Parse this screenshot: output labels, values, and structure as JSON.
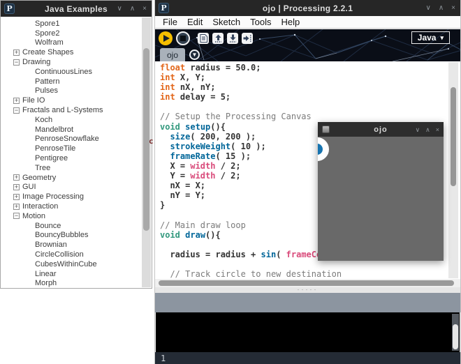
{
  "window_controls": {
    "minimize": "∨",
    "maximize": "∧",
    "close": "×"
  },
  "examples_window": {
    "logo": "P",
    "title": "Java Examples",
    "tree": [
      {
        "label": "Spore1",
        "level": 1,
        "toggle": null
      },
      {
        "label": "Spore2",
        "level": 1,
        "toggle": null
      },
      {
        "label": "Wolfram",
        "level": 1,
        "toggle": null
      },
      {
        "label": "Create Shapes",
        "level": 0,
        "toggle": "+"
      },
      {
        "label": "Drawing",
        "level": 0,
        "toggle": "−"
      },
      {
        "label": "ContinuousLines",
        "level": 1,
        "toggle": null
      },
      {
        "label": "Pattern",
        "level": 1,
        "toggle": null
      },
      {
        "label": "Pulses",
        "level": 1,
        "toggle": null
      },
      {
        "label": "File IO",
        "level": 0,
        "toggle": "+"
      },
      {
        "label": "Fractals and L-Systems",
        "level": 0,
        "toggle": "−"
      },
      {
        "label": "Koch",
        "level": 1,
        "toggle": null
      },
      {
        "label": "Mandelbrot",
        "level": 1,
        "toggle": null
      },
      {
        "label": "PenroseSnowflake",
        "level": 1,
        "toggle": null
      },
      {
        "label": "PenroseTile",
        "level": 1,
        "toggle": null
      },
      {
        "label": "Pentigree",
        "level": 1,
        "toggle": null
      },
      {
        "label": "Tree",
        "level": 1,
        "toggle": null
      },
      {
        "label": "Geometry",
        "level": 0,
        "toggle": "+"
      },
      {
        "label": "GUI",
        "level": 0,
        "toggle": "+"
      },
      {
        "label": "Image Processing",
        "level": 0,
        "toggle": "+"
      },
      {
        "label": "Interaction",
        "level": 0,
        "toggle": "+"
      },
      {
        "label": "Motion",
        "level": 0,
        "toggle": "−"
      },
      {
        "label": "Bounce",
        "level": 1,
        "toggle": null
      },
      {
        "label": "BouncyBubbles",
        "level": 1,
        "toggle": null
      },
      {
        "label": "Brownian",
        "level": 1,
        "toggle": null
      },
      {
        "label": "CircleCollision",
        "level": 1,
        "toggle": null
      },
      {
        "label": "CubesWithinCube",
        "level": 1,
        "toggle": null
      },
      {
        "label": "Linear",
        "level": 1,
        "toggle": null
      },
      {
        "label": "Morph",
        "level": 1,
        "toggle": null
      }
    ]
  },
  "editor_window": {
    "logo": "P",
    "title": "ojo | Processing 2.2.1",
    "menu": [
      "File",
      "Edit",
      "Sketch",
      "Tools",
      "Help"
    ],
    "toolbar": {
      "buttons": [
        "run-icon",
        "stop-icon",
        "new-sketch-icon",
        "open-icon",
        "save-icon",
        "export-icon"
      ],
      "mode_selector": {
        "label": "Java",
        "caret": "▾"
      }
    },
    "tab": {
      "label": "ojo",
      "menu_caret": "▼"
    },
    "splitter_dots": "·····",
    "status": {
      "line_number": "1"
    },
    "syntax_colors": {
      "keyword": "#E2661A",
      "type": "#33997E",
      "function": "#006699",
      "special_variable": "#D94A7A",
      "comment": "#7B7B7B",
      "plain": "#333333"
    },
    "code_lines": [
      {
        "tokens": [
          {
            "t": "float",
            "c": "kw"
          },
          {
            "t": " radius = 50.0;",
            "c": "pl"
          }
        ]
      },
      {
        "tokens": [
          {
            "t": "int",
            "c": "kw"
          },
          {
            "t": " X, Y;",
            "c": "pl"
          }
        ]
      },
      {
        "tokens": [
          {
            "t": "int",
            "c": "kw"
          },
          {
            "t": " nX, nY;",
            "c": "pl"
          }
        ]
      },
      {
        "tokens": [
          {
            "t": "int",
            "c": "kw"
          },
          {
            "t": " delay = 5;",
            "c": "pl"
          }
        ]
      },
      {
        "tokens": []
      },
      {
        "tokens": [
          {
            "t": "// Setup the Processing Canvas",
            "c": "cm"
          }
        ]
      },
      {
        "tokens": [
          {
            "t": "void",
            "c": "ty"
          },
          {
            "t": " ",
            "c": "pl"
          },
          {
            "t": "setup",
            "c": "fnb"
          },
          {
            "t": "(){",
            "c": "pl"
          }
        ]
      },
      {
        "tokens": [
          {
            "t": "  ",
            "c": "pl"
          },
          {
            "t": "size",
            "c": "fn"
          },
          {
            "t": "( 200, 200 );",
            "c": "pl"
          }
        ]
      },
      {
        "tokens": [
          {
            "t": "  ",
            "c": "pl"
          },
          {
            "t": "strokeWeight",
            "c": "fn"
          },
          {
            "t": "( 10 );",
            "c": "pl"
          }
        ]
      },
      {
        "tokens": [
          {
            "t": "  ",
            "c": "pl"
          },
          {
            "t": "frameRate",
            "c": "fn"
          },
          {
            "t": "( 15 );",
            "c": "pl"
          }
        ]
      },
      {
        "tokens": [
          {
            "t": "  X = ",
            "c": "pl"
          },
          {
            "t": "width",
            "c": "vr"
          },
          {
            "t": " / 2;",
            "c": "pl"
          }
        ]
      },
      {
        "tokens": [
          {
            "t": "  Y = ",
            "c": "pl"
          },
          {
            "t": "width",
            "c": "vr"
          },
          {
            "t": " / 2;",
            "c": "pl"
          }
        ]
      },
      {
        "tokens": [
          {
            "t": "  nX = X;",
            "c": "pl"
          }
        ]
      },
      {
        "tokens": [
          {
            "t": "  nY = Y;",
            "c": "pl"
          }
        ]
      },
      {
        "tokens": [
          {
            "t": "}",
            "c": "pl"
          }
        ]
      },
      {
        "tokens": []
      },
      {
        "tokens": [
          {
            "t": "// Main draw loop",
            "c": "cm"
          }
        ]
      },
      {
        "tokens": [
          {
            "t": "void",
            "c": "ty"
          },
          {
            "t": " ",
            "c": "pl"
          },
          {
            "t": "draw",
            "c": "fnb"
          },
          {
            "t": "(){",
            "c": "pl"
          }
        ]
      },
      {
        "tokens": []
      },
      {
        "tokens": [
          {
            "t": "  radius = radius + ",
            "c": "pl"
          },
          {
            "t": "sin",
            "c": "fn"
          },
          {
            "t": "( ",
            "c": "pl"
          },
          {
            "t": "frameCount",
            "c": "vr"
          },
          {
            "t": " /",
            "c": "pl"
          }
        ]
      },
      {
        "tokens": []
      },
      {
        "tokens": [
          {
            "t": "  // Track circle to new destination",
            "c": "cm"
          }
        ]
      }
    ]
  },
  "sketch_window": {
    "title": "ojo",
    "canvas_color": "#696969",
    "circle_fill": "#1774B0",
    "circle_stroke": "#FFFFFF"
  },
  "artifacts": {
    "stray_char": "c"
  }
}
